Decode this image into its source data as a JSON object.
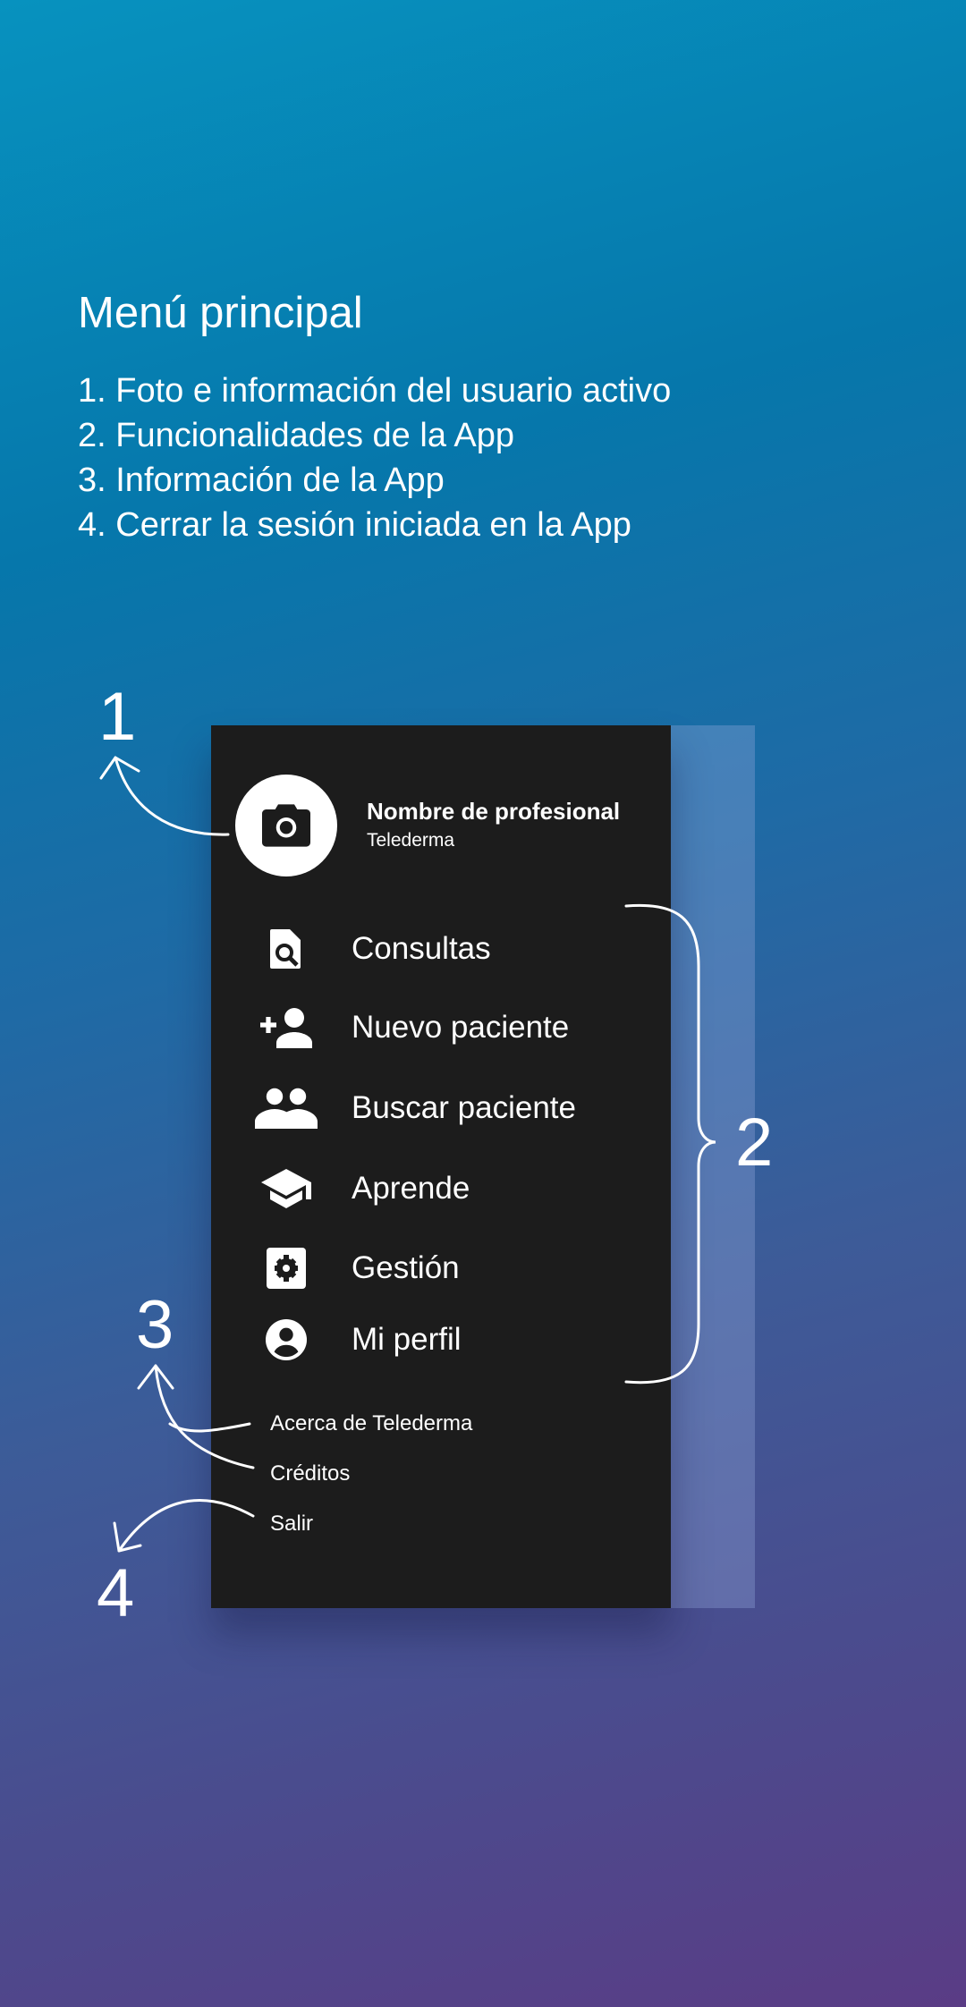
{
  "header": {
    "title": "Menú principal",
    "steps": [
      "1. Foto e información del usuario activo",
      "2. Funcionalidades de la App",
      "3. Información de la App",
      "4. Cerrar la sesión iniciada en la App"
    ]
  },
  "profile": {
    "name": "Nombre de profesional",
    "subtitle": "Telederma",
    "icon": "camera-icon"
  },
  "menu": [
    {
      "label": "Consultas",
      "icon": "document-search-icon"
    },
    {
      "label": "Nuevo paciente",
      "icon": "person-add-icon"
    },
    {
      "label": "Buscar paciente",
      "icon": "people-icon"
    },
    {
      "label": "Aprende",
      "icon": "school-icon"
    },
    {
      "label": "Gestión",
      "icon": "settings-icon"
    },
    {
      "label": "Mi perfil",
      "icon": "account-circle-icon"
    }
  ],
  "secondary": [
    "Acerca de Telederma",
    "Créditos",
    "Salir"
  ],
  "annotations": [
    "1",
    "2",
    "3",
    "4"
  ]
}
